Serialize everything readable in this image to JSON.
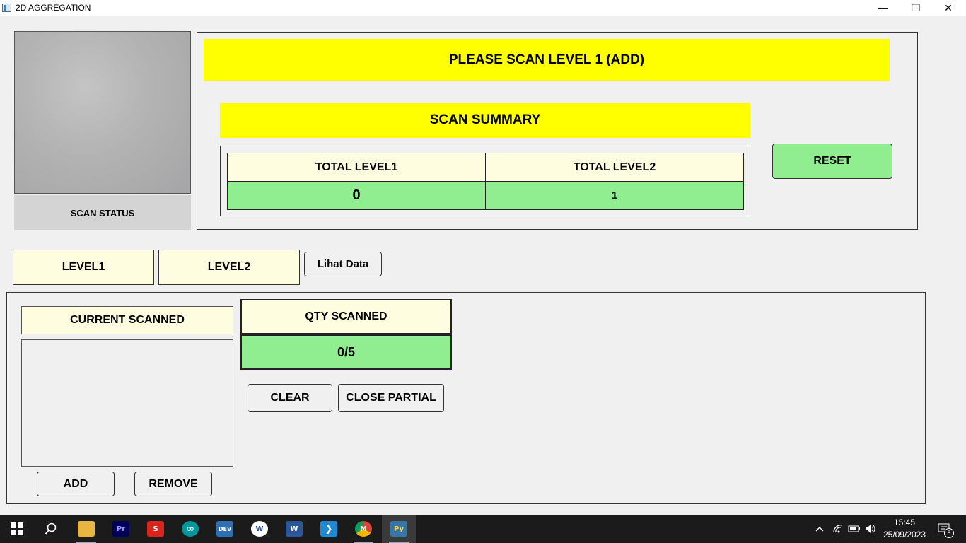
{
  "window": {
    "title": "2D AGGREGATION",
    "minimize_glyph": "—",
    "maximize_glyph": "❐",
    "close_glyph": "✕"
  },
  "camera": {
    "status_label": "SCAN STATUS"
  },
  "banner": {
    "text": "PLEASE SCAN LEVEL 1 (ADD)",
    "color": "#ffff00"
  },
  "summary": {
    "title": "SCAN SUMMARY",
    "headers": [
      "TOTAL LEVEL1",
      "TOTAL LEVEL2"
    ],
    "values": [
      "0",
      "1"
    ],
    "header_color": "#fffde0",
    "value_color": "#90ee90"
  },
  "buttons": {
    "reset": "RESET",
    "lihat_data": "Lihat Data",
    "clear": "CLEAR",
    "close_partial": "CLOSE PARTIAL",
    "add": "ADD",
    "remove": "REMOVE"
  },
  "tabs": {
    "level1": "LEVEL1",
    "level2": "LEVEL2"
  },
  "current": {
    "header": "CURRENT SCANNED",
    "items": []
  },
  "qty": {
    "header": "QTY SCANNED",
    "value": "0/5"
  },
  "taskbar": {
    "apps": [
      {
        "name": "file-explorer-icon",
        "glyph": "",
        "color": "#e8b640"
      },
      {
        "name": "premiere-pro-icon",
        "glyph": "Pr",
        "color": "#00005b"
      },
      {
        "name": "sketchup-icon",
        "glyph": "S",
        "color": "#d9251d"
      },
      {
        "name": "arduino-icon",
        "glyph": "∞",
        "color": "#00979c"
      },
      {
        "name": "dev-cpp-icon",
        "glyph": "DEV",
        "color": "#2d6fb5"
      },
      {
        "name": "wps-icon",
        "glyph": "W",
        "color": "#ffffff"
      },
      {
        "name": "word-icon",
        "glyph": "W",
        "color": "#2b579a"
      },
      {
        "name": "vscode-icon",
        "glyph": "❯",
        "color": "#1f8ad2"
      },
      {
        "name": "chrome-icon",
        "glyph": "M",
        "color": "#db4437"
      },
      {
        "name": "python-icon",
        "glyph": "Py",
        "color": "#3776ab"
      }
    ],
    "clock_time": "15:45",
    "clock_date": "25/09/2023",
    "notification_count": "5"
  }
}
